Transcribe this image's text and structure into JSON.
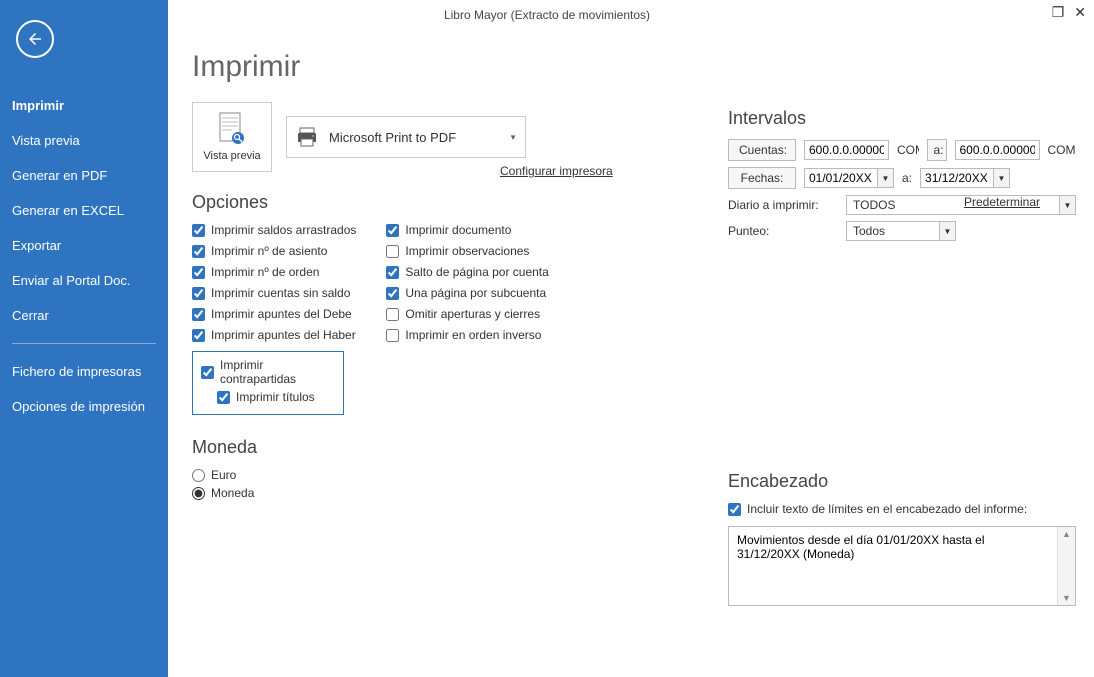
{
  "window": {
    "title": "Libro Mayor (Extracto de movimientos)"
  },
  "sidebar": {
    "items": [
      "Imprimir",
      "Vista previa",
      "Generar en PDF",
      "Generar en EXCEL",
      "Exportar",
      "Enviar al Portal Doc.",
      "Cerrar"
    ],
    "sub_items": [
      "Fichero de impresoras",
      "Opciones de impresión"
    ]
  },
  "page": {
    "title": "Imprimir",
    "preview_label": "Vista previa",
    "printer_name": "Microsoft Print to PDF",
    "config_link": "Configurar impresora",
    "opciones_head": "Opciones",
    "predeterminar": "Predeterminar",
    "moneda_head": "Moneda",
    "intervalos_head": "Intervalos",
    "encabezado_head": "Encabezado"
  },
  "opciones": {
    "col1": [
      {
        "label": "Imprimir saldos arrastrados",
        "checked": true
      },
      {
        "label": "Imprimir nº de asiento",
        "checked": true
      },
      {
        "label": "Imprimir nº de orden",
        "checked": true
      },
      {
        "label": "Imprimir cuentas sin saldo",
        "checked": true
      },
      {
        "label": "Imprimir apuntes del Debe",
        "checked": true
      },
      {
        "label": "Imprimir apuntes del Haber",
        "checked": true
      }
    ],
    "highlight": [
      {
        "label": "Imprimir contrapartidas",
        "checked": true
      },
      {
        "label": "Imprimir títulos",
        "checked": true
      }
    ],
    "col2": [
      {
        "label": "Imprimir documento",
        "checked": true
      },
      {
        "label": "Imprimir observaciones",
        "checked": false
      },
      {
        "label": "Salto de página por cuenta",
        "checked": true
      },
      {
        "label": "Una página por subcuenta",
        "checked": true
      },
      {
        "label": "Omitir aperturas y cierres",
        "checked": false
      },
      {
        "label": "Imprimir en orden inverso",
        "checked": false
      }
    ]
  },
  "moneda": {
    "euro": "Euro",
    "moneda": "Moneda",
    "selected": "moneda"
  },
  "intervalos": {
    "cuentas_btn": "Cuentas:",
    "fechas_btn": "Fechas:",
    "diario_lbl": "Diario a imprimir:",
    "punteo_lbl": "Punteo:",
    "a_lbl": "a:",
    "cuenta_from": "600.0.0.00000",
    "cuenta_from_desc": "COMPRAS DE MER",
    "cuenta_to": "600.0.0.00000",
    "cuenta_to_desc": "COMPRAS DE MERC",
    "fecha_from": "01/01/20XX",
    "fecha_to": "31/12/20XX",
    "diario_val": "TODOS",
    "punteo_val": "Todos"
  },
  "encabezado": {
    "check_label": "Incluir texto de límites en el encabezado del informe:",
    "text": "Movimientos desde el día 01/01/20XX hasta el 31/12/20XX (Moneda)"
  }
}
